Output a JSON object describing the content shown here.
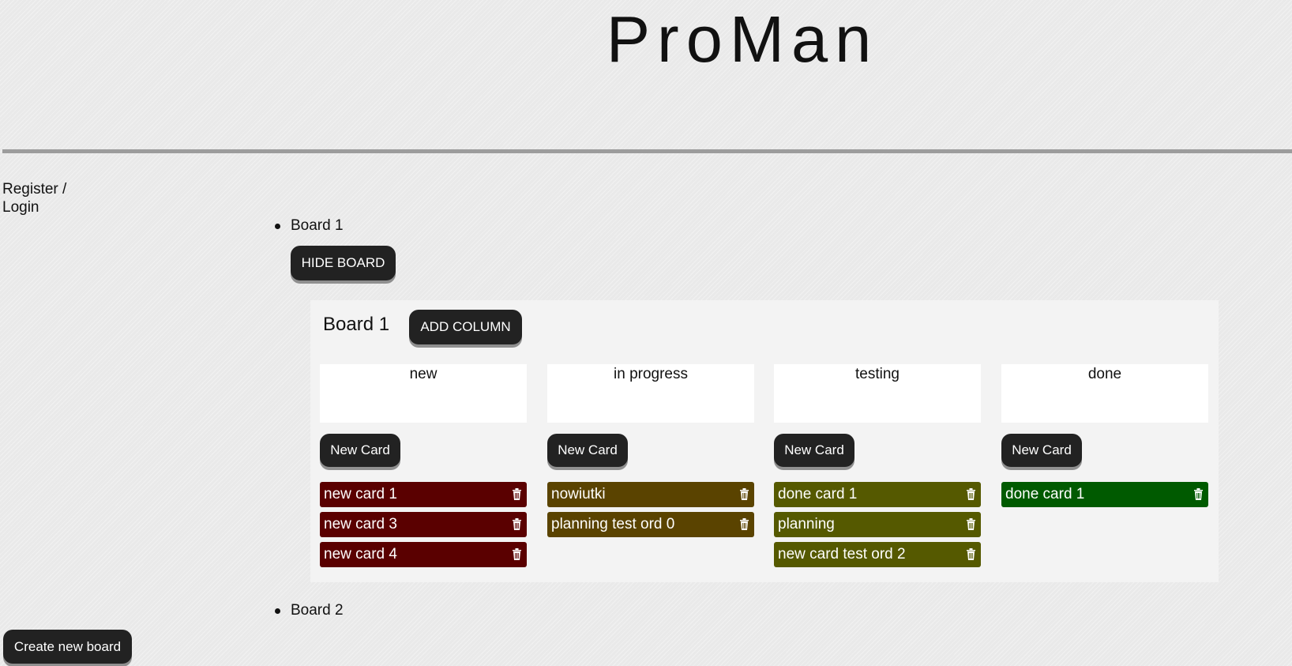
{
  "app": {
    "title": "ProMan"
  },
  "auth": {
    "login_link": "Register / Login"
  },
  "boards": [
    {
      "name": "Board 1",
      "toggle_label": "HIDE BOARD"
    },
    {
      "name": "Board 2"
    }
  ],
  "open_board": {
    "title": "Board 1",
    "add_column_label": "ADD COLUMN",
    "new_card_label": "New Card",
    "columns": [
      {
        "title": "new",
        "cards": [
          "new card 1",
          "new card 3",
          "new card 4"
        ]
      },
      {
        "title": "in progress",
        "cards": [
          "nowiutki",
          "planning test ord 0"
        ]
      },
      {
        "title": "testing",
        "cards": [
          "done card 1",
          "planning",
          "new card test ord 2"
        ]
      },
      {
        "title": "done",
        "cards": [
          "done card 1"
        ]
      }
    ]
  },
  "footer": {
    "create_board_label": "Create new board"
  },
  "colors": {
    "button_bg": "#222222",
    "column_new": "#5a0000",
    "column_in_progress": "#5a4300",
    "column_testing": "#555900",
    "column_done": "#005a00"
  },
  "icons": {
    "card_delete": "trash-icon"
  }
}
